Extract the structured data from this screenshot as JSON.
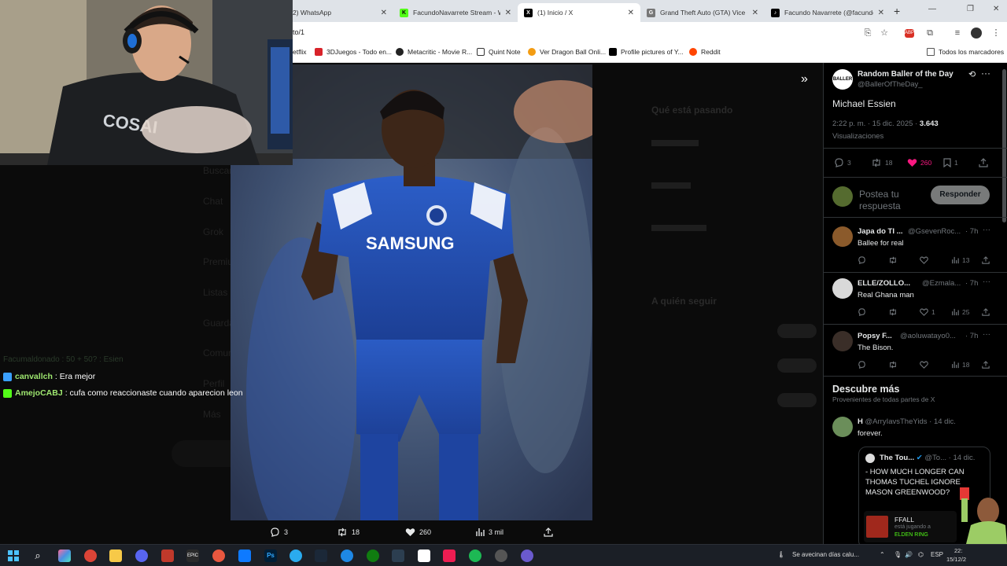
{
  "browser": {
    "tabs": [
      {
        "label": "2) WhatsApp",
        "icon": "whatsapp-icon",
        "color": "#25d366"
      },
      {
        "label": "FacundoNavarrete Stream - Wa",
        "icon": "kick-icon",
        "color": "#53fc18"
      },
      {
        "label": "(1) Inicio / X",
        "icon": "x-icon",
        "color": "#000000"
      },
      {
        "label": "Grand Theft Auto (GTA) Vice Ci",
        "icon": "gta-icon",
        "color": "#666666"
      },
      {
        "label": "Facundo Navarrete (@facundo",
        "icon": "tiktok-icon",
        "color": "#000000"
      }
    ],
    "url": "to/1",
    "bookmarks": [
      {
        "label": "etflix",
        "icon": "netflix-icon",
        "color": "#e50914"
      },
      {
        "label": "3DJuegos - Todo en...",
        "icon": "3djuegos-icon",
        "color": "#d8232a"
      },
      {
        "label": "Metacritic - Movie R...",
        "icon": "metacritic-icon",
        "color": "#222222"
      },
      {
        "label": "Quint Note",
        "icon": "notion-icon",
        "color": "#333333"
      },
      {
        "label": "Ver Dragon Ball Onli...",
        "icon": "dragonball-icon",
        "color": "#f39c12"
      },
      {
        "label": "Profile pictures of Y...",
        "icon": "x-icon",
        "color": "#000000"
      },
      {
        "label": "Reddit",
        "icon": "reddit-icon",
        "color": "#ff4500"
      }
    ],
    "all_bookmarks": "Todos los marcadores"
  },
  "chat": [
    {
      "user": "canvallch",
      "message": ": Era mejor",
      "user_color": "#9fe870",
      "badge_color": "#3aa0ff"
    },
    {
      "user": "AmejoCABJ",
      "message": ": cufa como reaccionaste cuando aparecion leon",
      "user_color": "#9fe870",
      "badge_color": "#53fc18"
    }
  ],
  "chat_faded": "Facumaldonado : 50 + 50? : Esien",
  "media_actions": {
    "replies": "3",
    "reposts": "18",
    "likes": "260",
    "views": "3 mil"
  },
  "background_timeline": {
    "whats_happening": "Qué está pasando",
    "who_to_follow": "A quién seguir",
    "nav": [
      "Buscar",
      "Chat",
      "Grok",
      "Premium",
      "Listas",
      "Guardados",
      "Comunidades",
      "Perfil",
      "Más"
    ]
  },
  "tweet": {
    "author": "Random Baller of the Day",
    "handle": "@BallerOfTheDay_",
    "text": "Michael Essien",
    "time": "2:22 p. m. · 15 dic. 2025 · ",
    "views_count": "3.643",
    "views_label": "Visualizaciones",
    "replies": "3",
    "reposts": "18",
    "likes": "260",
    "bookmarks": "1",
    "like_color": "#f91880"
  },
  "reply_box": {
    "placeholder": "Postea tu respuesta",
    "button": "Responder"
  },
  "replies": [
    {
      "name": "Japa do TI ...",
      "handle": "@GsevenRoc...",
      "time": "· 7h",
      "text": "Ballee for real",
      "likes": "",
      "views": "13"
    },
    {
      "name": "ELLE/ZOLLO...",
      "handle": "@Ezmala...",
      "time": "· 7h",
      "text": "Real Ghana man",
      "likes": "1",
      "views": "25"
    },
    {
      "name": "Popsy F...",
      "handle": "@aoluwatayo0...",
      "time": "· 7h",
      "text": "The Bison.",
      "likes": "",
      "views": "18"
    }
  ],
  "discover": {
    "title": "Descubre más",
    "subtitle": "Provenientes de todas partes de X",
    "post": {
      "name": "H",
      "handle": "@ArryIavsTheYids",
      "time": "· 14 dic.",
      "text": "forever."
    },
    "quote": {
      "name": "The Tou...",
      "handle": "@To...",
      "time": "· 14 dic.",
      "text": "- HOW MUCH LONGER CAN THOMAS TUCHEL IGNORE MASON GREENWOOD?"
    }
  },
  "stream_overlay": {
    "name": "FFALL",
    "status": "está jugando a",
    "game": "ELDEN RING"
  },
  "taskbar": {
    "weather": "Se avecinan días calu...",
    "lang": "ESP",
    "time": "22:",
    "date": "15/12/2"
  }
}
